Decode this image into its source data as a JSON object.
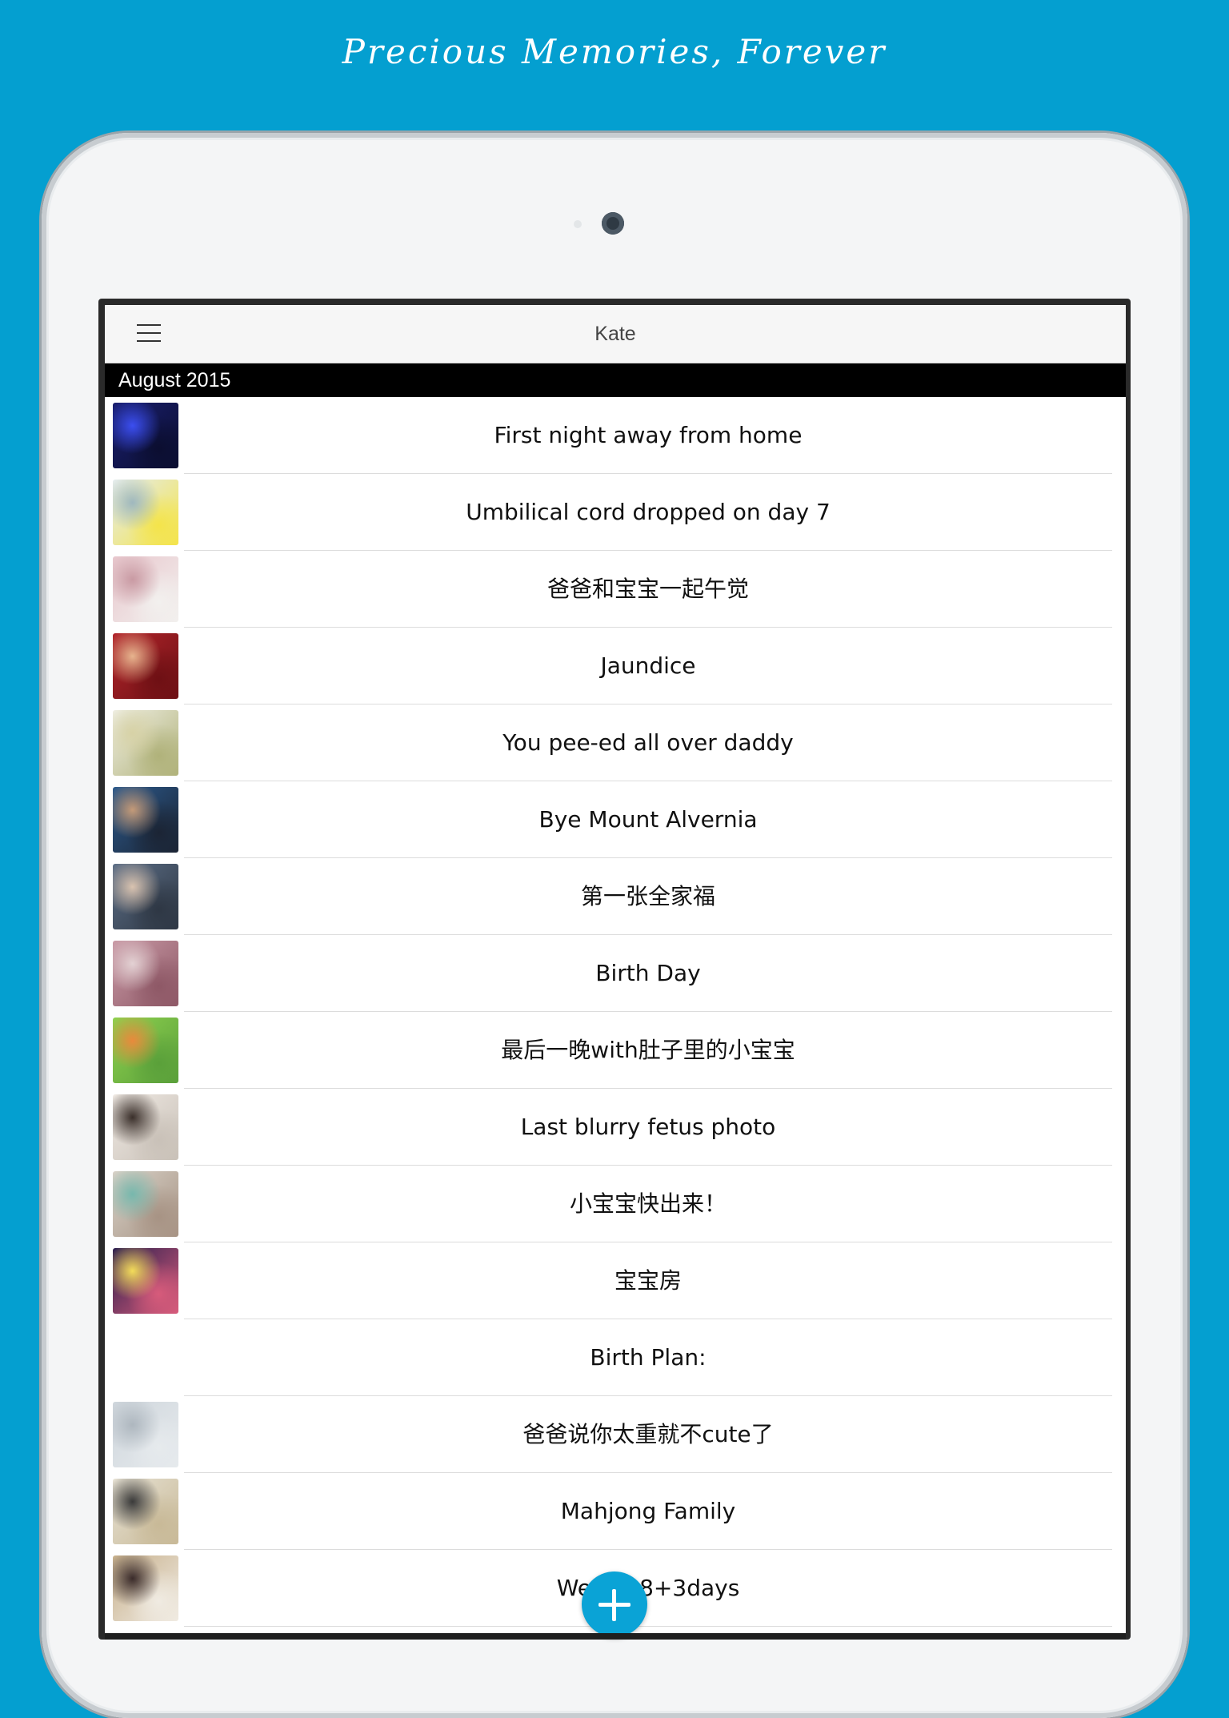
{
  "tagline": "Precious Memories, Forever",
  "app": {
    "title": "Kate",
    "section": "August 2015"
  },
  "entries": [
    {
      "title": "First night away from home",
      "thumb": "photo-incubator-blue",
      "colors": [
        "#1a1f6e",
        "#3b4ef0",
        "#0b0e30"
      ]
    },
    {
      "title": "Umbilical cord dropped on day 7",
      "thumb": "photo-cord",
      "colors": [
        "#e4ecef",
        "#9fb8be",
        "#f4e44a"
      ]
    },
    {
      "title": "爸爸和宝宝一起午觉",
      "thumb": "photo-nap",
      "colors": [
        "#e8c7cd",
        "#c99aa3",
        "#f2f0ee"
      ]
    },
    {
      "title": "Jaundice",
      "thumb": "photo-jaundice",
      "colors": [
        "#b1252b",
        "#e7b48e",
        "#6e1014"
      ]
    },
    {
      "title": "You pee-ed all over daddy",
      "thumb": "photo-diaper",
      "colors": [
        "#efeee2",
        "#d7d2a6",
        "#b0b27a"
      ]
    },
    {
      "title": "Bye Mount Alvernia",
      "thumb": "photo-family-hospital",
      "colors": [
        "#2c5a8c",
        "#c49a78",
        "#1b2434"
      ]
    },
    {
      "title": "第一张全家福",
      "thumb": "photo-first-family",
      "colors": [
        "#5c6e86",
        "#d9c3b0",
        "#2e3744"
      ]
    },
    {
      "title": "Birth Day",
      "thumb": "photo-newborn",
      "colors": [
        "#c99aa6",
        "#e3d1d3",
        "#8e5866"
      ]
    },
    {
      "title": "最后一晚with肚子里的小宝宝",
      "thumb": "photo-bump",
      "colors": [
        "#8fd14f",
        "#e98a3c",
        "#5aa03a"
      ]
    },
    {
      "title": "Last blurry fetus photo",
      "thumb": "photo-ultrasound",
      "colors": [
        "#efe9e3",
        "#3a2f2a",
        "#c9c1b8"
      ]
    },
    {
      "title": "小宝宝快出来！",
      "thumb": "photo-couple",
      "colors": [
        "#d8d2c8",
        "#77b8ad",
        "#a79384"
      ]
    },
    {
      "title": "宝宝房",
      "thumb": "photo-nursery",
      "colors": [
        "#2c1f4e",
        "#f3dc5a",
        "#d75b7b"
      ]
    },
    {
      "title": "Birth Plan:",
      "thumb": "",
      "colors": []
    },
    {
      "title": "爸爸说你太重就不cute了",
      "thumb": "photo-paper",
      "colors": [
        "#cfd6dc",
        "#aeb7bf",
        "#e6eaed"
      ]
    },
    {
      "title": "Mahjong Family",
      "thumb": "photo-mahjong",
      "colors": [
        "#e7e2d4",
        "#3a3a3a",
        "#c8b997"
      ]
    },
    {
      "title": "Week 38+3days",
      "thumb": "photo-dinner",
      "colors": [
        "#c7b08c",
        "#3a2b2a",
        "#f0ebe2"
      ]
    }
  ]
}
